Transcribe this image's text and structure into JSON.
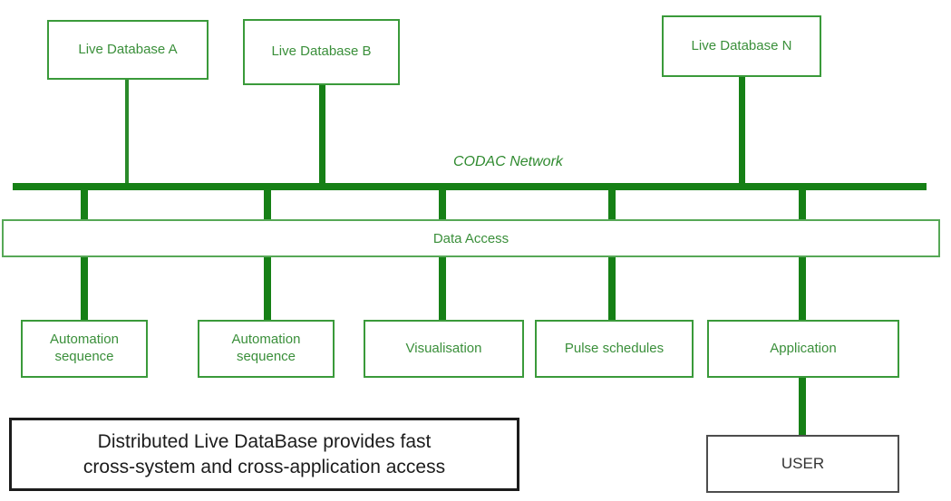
{
  "diagram": {
    "title_label": "CODAC Network",
    "network_label": "CODAC Network",
    "databases": [
      {
        "label": "Live Database A"
      },
      {
        "label": "Live Database B"
      },
      {
        "label": "Live Database N"
      }
    ],
    "middle_bar": {
      "label": "Data Access"
    },
    "consumers": [
      {
        "label_line1": "Automation",
        "label_line2": "sequence"
      },
      {
        "label_line1": "Automation",
        "label_line2": "sequence"
      },
      {
        "label_line1": "Visualisation",
        "label_line2": ""
      },
      {
        "label_line1": "Pulse schedules",
        "label_line2": ""
      },
      {
        "label_line1": "Application",
        "label_line2": ""
      }
    ],
    "user_box": {
      "label": "USER"
    },
    "caption": {
      "line1": "Distributed Live DataBase provides fast",
      "line2": "cross-system and cross-application access"
    },
    "colors": {
      "line_green": "#168016",
      "box_green": "#3a9a3a",
      "text_green": "#3a8f3a",
      "label_green": "#2f8a2f",
      "dark_border": "#4d4d4d",
      "caption_border": "#1c1c1c",
      "background": "#ffffff"
    }
  }
}
